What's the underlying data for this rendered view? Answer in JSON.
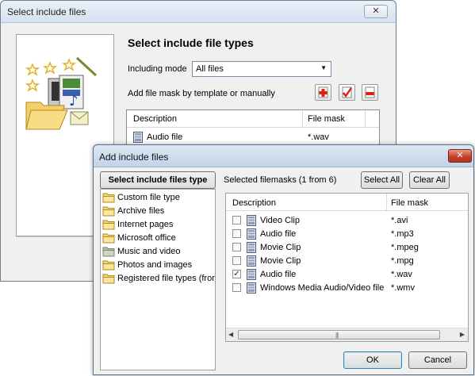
{
  "back_window": {
    "title": "Select include files",
    "close_glyph": "✕",
    "heading": "Select include file types",
    "including_mode_label": "Including mode",
    "including_mode_value": "All files",
    "add_mask_label": "Add file mask by template or manually",
    "list_headers": [
      "Description",
      "File mask"
    ],
    "rows": [
      {
        "description": "Audio file",
        "mask": "*.wav"
      }
    ]
  },
  "dialog": {
    "title": "Add include files",
    "close_glyph": "✕",
    "categories_header": "Select include files type",
    "categories": [
      {
        "label": "Custom file type",
        "selected": false
      },
      {
        "label": "Archive files",
        "selected": false
      },
      {
        "label": "Internet pages",
        "selected": false
      },
      {
        "label": "Microsoft office",
        "selected": false
      },
      {
        "label": "Music and video",
        "selected": true
      },
      {
        "label": "Photos and images",
        "selected": false
      },
      {
        "label": "Registered file types (from w",
        "selected": false
      }
    ],
    "selected_label": "Selected filemasks (1 from 6)",
    "select_all": "Select All",
    "clear_all": "Clear All",
    "list_headers": [
      "Description",
      "File mask"
    ],
    "masks": [
      {
        "description": "Video Clip",
        "mask": "*.avi",
        "checked": false
      },
      {
        "description": "Audio file",
        "mask": "*.mp3",
        "checked": false
      },
      {
        "description": "Movie Clip",
        "mask": "*.mpeg",
        "checked": false
      },
      {
        "description": "Movie Clip",
        "mask": "*.mpg",
        "checked": false
      },
      {
        "description": "Audio file",
        "mask": "*.wav",
        "checked": true
      },
      {
        "description": "Windows Media Audio/Video file",
        "mask": "*.wmv",
        "checked": false
      }
    ],
    "check_glyph": "✓",
    "ok": "OK",
    "cancel": "Cancel"
  }
}
